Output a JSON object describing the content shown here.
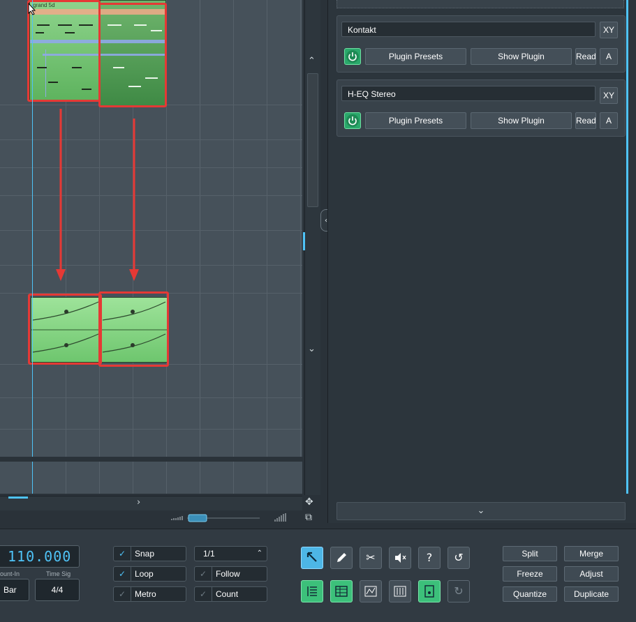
{
  "clips": {
    "top_clip_label": "grand 5d"
  },
  "plugins": [
    {
      "name": "Kontakt",
      "xy_label": "XY",
      "presets_label": "Plugin Presets",
      "show_label": "Show Plugin",
      "read_label": "Read",
      "a_label": "A"
    },
    {
      "name": "H-EQ Stereo",
      "xy_label": "XY",
      "presets_label": "Plugin Presets",
      "show_label": "Show Plugin",
      "read_label": "Read",
      "a_label": "A"
    }
  ],
  "transport": {
    "tempo": "110.000",
    "count_in_label": "ount-In",
    "count_in_value": "Bar",
    "time_sig_label": "Time Sig",
    "time_sig_value": "4/4"
  },
  "options": {
    "snap": "Snap",
    "loop": "Loop",
    "metro": "Metro",
    "quantize_value": "1/1",
    "follow": "Follow",
    "count": "Count"
  },
  "tools": {
    "row1": [
      "pointer",
      "pencil",
      "scissors",
      "mute",
      "help",
      "undo"
    ],
    "row2": [
      "list-view",
      "grid-view",
      "mixer-graph",
      "mixer-faders",
      "tempo-track",
      "redo"
    ],
    "help_glyph": "?"
  },
  "actions": {
    "split": "Split",
    "merge": "Merge",
    "freeze": "Freeze",
    "adjust": "Adjust",
    "quantize": "Quantize",
    "duplicate": "Duplicate"
  },
  "colors": {
    "accent": "#4fc3f7",
    "highlight_red": "#e53935",
    "clip_green": "#7ccc78",
    "power_green": "#2aa86b"
  }
}
